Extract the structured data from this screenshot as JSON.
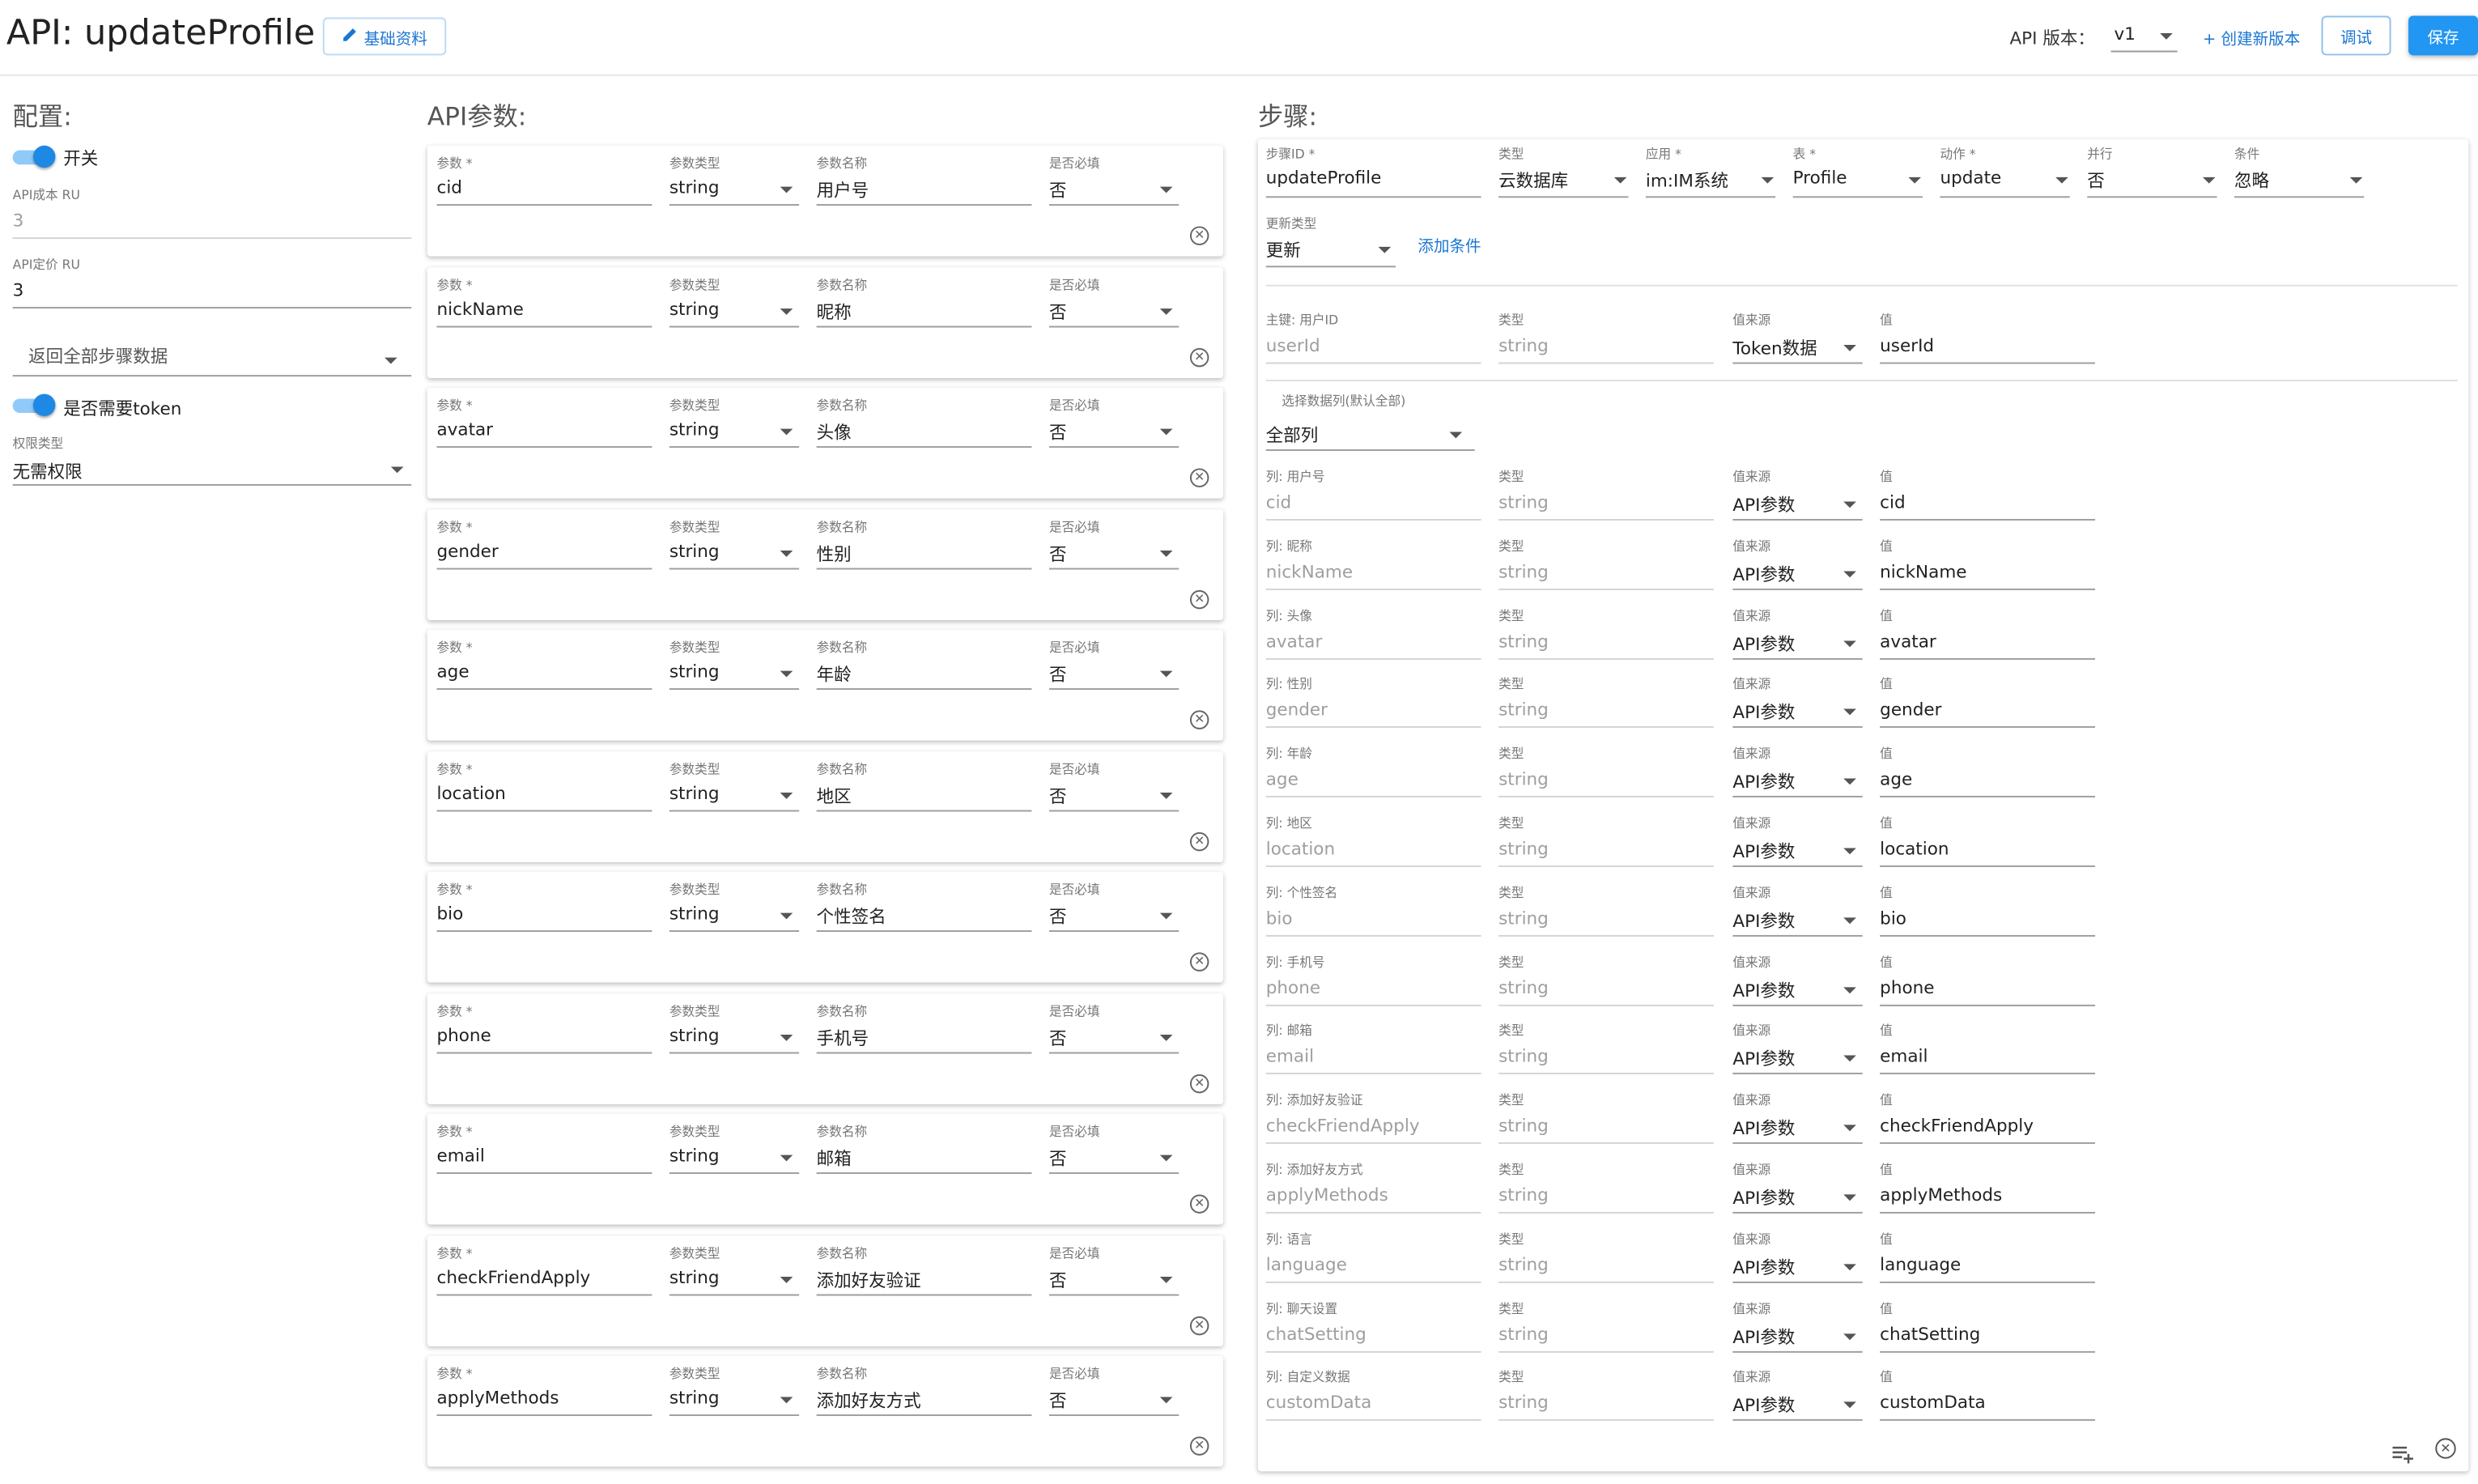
{
  "header": {
    "title": "API: updateProfile",
    "edit_button": "基础资料",
    "version_label": "API 版本：",
    "version_value": "v1",
    "create_version": "+ 创建新版本",
    "debug_button": "调试",
    "save_button": "保存"
  },
  "config": {
    "title": "配置:",
    "switch_label": "开关",
    "cost_label": "API成本 RU",
    "cost_value": "3",
    "price_label": "API定价 RU",
    "price_value": "3",
    "return_select": "返回全部步骤数据",
    "token_label": "是否需要token",
    "perm_label": "权限类型",
    "perm_value": "无需权限"
  },
  "params": {
    "title": "API参数:",
    "field_labels": {
      "param": "参数 *",
      "type": "参数类型",
      "name": "参数名称",
      "required": "是否必填"
    },
    "items": [
      {
        "param": "cid",
        "type": "string",
        "name": "用户号",
        "required": "否"
      },
      {
        "param": "nickName",
        "type": "string",
        "name": "昵称",
        "required": "否"
      },
      {
        "param": "avatar",
        "type": "string",
        "name": "头像",
        "required": "否"
      },
      {
        "param": "gender",
        "type": "string",
        "name": "性别",
        "required": "否"
      },
      {
        "param": "age",
        "type": "string",
        "name": "年龄",
        "required": "否"
      },
      {
        "param": "location",
        "type": "string",
        "name": "地区",
        "required": "否"
      },
      {
        "param": "bio",
        "type": "string",
        "name": "个性签名",
        "required": "否"
      },
      {
        "param": "phone",
        "type": "string",
        "name": "手机号",
        "required": "否"
      },
      {
        "param": "email",
        "type": "string",
        "name": "邮箱",
        "required": "否"
      },
      {
        "param": "checkFriendApply",
        "type": "string",
        "name": "添加好友验证",
        "required": "否"
      },
      {
        "param": "applyMethods",
        "type": "string",
        "name": "添加好友方式",
        "required": "否"
      }
    ]
  },
  "steps": {
    "title": "步骤:",
    "header_fields": [
      {
        "label": "步骤ID *",
        "value": "updateProfile",
        "dropdown": false
      },
      {
        "label": "类型",
        "value": "云数据库",
        "dropdown": true
      },
      {
        "label": "应用 *",
        "value": "im:IM系统",
        "dropdown": true
      },
      {
        "label": "表 *",
        "value": "Profile",
        "dropdown": true
      },
      {
        "label": "动作 *",
        "value": "update",
        "dropdown": true
      },
      {
        "label": "并行",
        "value": "否",
        "dropdown": true
      },
      {
        "label": "条件",
        "value": "忽略",
        "dropdown": true
      }
    ],
    "update_type_label": "更新类型",
    "update_type_value": "更新",
    "add_condition": "添加条件",
    "key_row": {
      "key_label": "主键: 用户ID",
      "key_value": "userId",
      "type_label": "类型",
      "type_value": "string",
      "src_label": "值来源",
      "src_value": "Token数据",
      "val_label": "值",
      "val_value": "userId"
    },
    "select_cols_label": "选择数据列(默认全部)",
    "select_cols_value": "全部列",
    "column_labels": {
      "type": "类型",
      "src": "值来源",
      "val": "值"
    },
    "columns": [
      {
        "label": "列: 用户号",
        "col": "cid",
        "type": "string",
        "src": "API参数",
        "val": "cid"
      },
      {
        "label": "列: 昵称",
        "col": "nickName",
        "type": "string",
        "src": "API参数",
        "val": "nickName"
      },
      {
        "label": "列: 头像",
        "col": "avatar",
        "type": "string",
        "src": "API参数",
        "val": "avatar"
      },
      {
        "label": "列: 性别",
        "col": "gender",
        "type": "string",
        "src": "API参数",
        "val": "gender"
      },
      {
        "label": "列: 年龄",
        "col": "age",
        "type": "string",
        "src": "API参数",
        "val": "age"
      },
      {
        "label": "列: 地区",
        "col": "location",
        "type": "string",
        "src": "API参数",
        "val": "location"
      },
      {
        "label": "列: 个性签名",
        "col": "bio",
        "type": "string",
        "src": "API参数",
        "val": "bio"
      },
      {
        "label": "列: 手机号",
        "col": "phone",
        "type": "string",
        "src": "API参数",
        "val": "phone"
      },
      {
        "label": "列: 邮箱",
        "col": "email",
        "type": "string",
        "src": "API参数",
        "val": "email"
      },
      {
        "label": "列: 添加好友验证",
        "col": "checkFriendApply",
        "type": "string",
        "src": "API参数",
        "val": "checkFriendApply"
      },
      {
        "label": "列: 添加好友方式",
        "col": "applyMethods",
        "type": "string",
        "src": "API参数",
        "val": "applyMethods"
      },
      {
        "label": "列: 语言",
        "col": "language",
        "type": "string",
        "src": "API参数",
        "val": "language"
      },
      {
        "label": "列: 聊天设置",
        "col": "chatSetting",
        "type": "string",
        "src": "API参数",
        "val": "chatSetting"
      },
      {
        "label": "列: 自定义数据",
        "col": "customData",
        "type": "string",
        "src": "API参数",
        "val": "customData"
      }
    ]
  },
  "colors": {
    "primary": "#2196f3",
    "accent": "#1976d2"
  }
}
